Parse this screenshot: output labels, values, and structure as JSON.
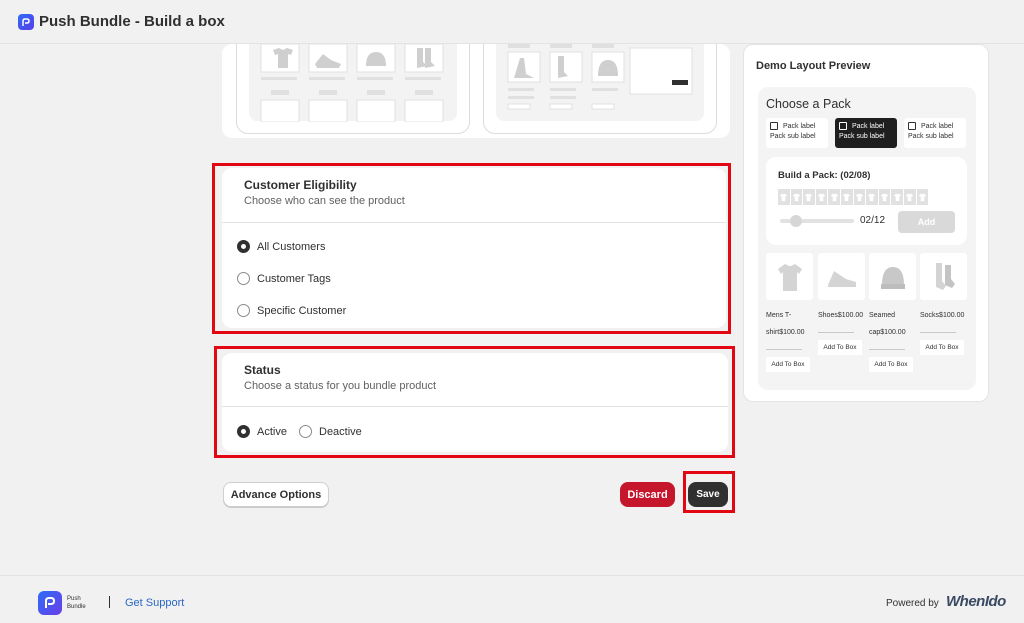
{
  "header": {
    "title": "Push Bundle - Build a box"
  },
  "eligibility": {
    "title": "Customer Eligibility",
    "subtitle": "Choose who can see the product",
    "options": [
      "All Customers",
      "Customer Tags",
      "Specific Customer"
    ],
    "selected": "All Customers"
  },
  "status": {
    "title": "Status",
    "subtitle": "Choose a status for you bundle product",
    "options": [
      "Active",
      "Deactive"
    ],
    "selected": "Active"
  },
  "actions": {
    "advance_label": "Advance Options",
    "discard_label": "Discard",
    "save_label": "Save"
  },
  "demo": {
    "title": "Demo Layout Preview",
    "choose_title": "Choose a Pack",
    "packs": [
      {
        "label": "Pack label",
        "sub": "Pack sub label",
        "active": false
      },
      {
        "label": "Pack label",
        "sub": "Pack sub label",
        "active": true
      },
      {
        "label": "Pack label",
        "sub": "Pack sub label",
        "active": false
      }
    ],
    "build_title": "Build a Pack: (02/08)",
    "count": "02/12",
    "add_label": "Add",
    "products": [
      {
        "name": "Mens T-shirt$100.00",
        "icon": "tshirt-icon"
      },
      {
        "name": "Shoes$100.00",
        "icon": "shoe-icon"
      },
      {
        "name": "Seamed cap$100.00",
        "icon": "beanie-icon"
      },
      {
        "name": "Socks$100.00",
        "icon": "socks-icon"
      }
    ],
    "add_to_box": "Add To Box"
  },
  "footer": {
    "brand": "Push Bundle",
    "support": "Get Support",
    "powered": "Powered by",
    "company": "WhenIdo"
  },
  "colors": {
    "highlight": "#e30613",
    "discard": "#c5162c",
    "save": "#303030",
    "link": "#2a66c2"
  }
}
